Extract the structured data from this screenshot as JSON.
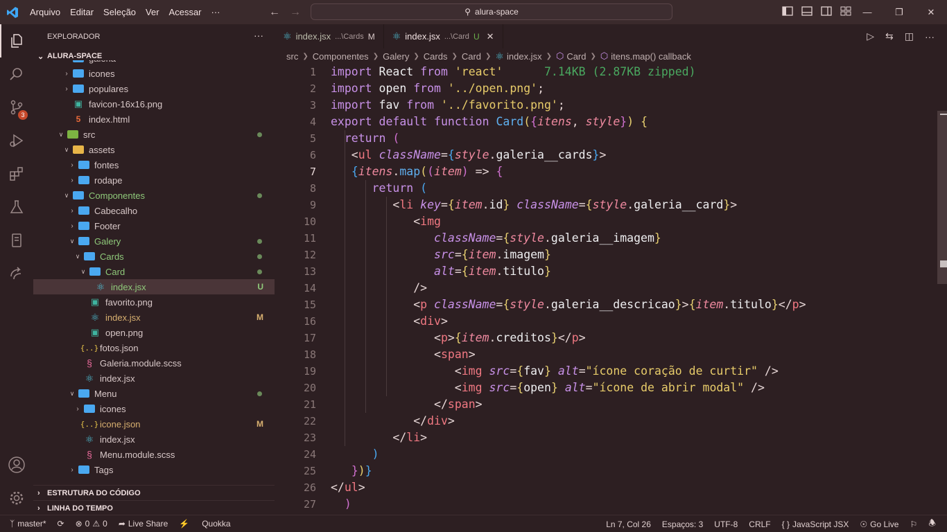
{
  "titlebar": {
    "menu": [
      "Arquivo",
      "Editar",
      "Seleção",
      "Ver",
      "Acessar",
      "···"
    ],
    "command_center": "alura-space"
  },
  "activity": {
    "scm_badge": "3"
  },
  "sidebar": {
    "title": "EXPLORADOR",
    "more": "···",
    "root": "ALURA-SPACE",
    "partial_top": "galeria",
    "items": [
      {
        "label": "icones",
        "depth": 2,
        "kind": "folder",
        "open": false
      },
      {
        "label": "populares",
        "depth": 2,
        "kind": "folder",
        "open": false
      },
      {
        "label": "favicon-16x16.png",
        "depth": 2,
        "kind": "img"
      },
      {
        "label": "index.html",
        "depth": 2,
        "kind": "html"
      },
      {
        "label": "src",
        "depth": 1,
        "kind": "src",
        "open": true,
        "dot": true
      },
      {
        "label": "assets",
        "depth": 2,
        "kind": "assets",
        "open": true
      },
      {
        "label": "fontes",
        "depth": 3,
        "kind": "folder",
        "open": false
      },
      {
        "label": "rodape",
        "depth": 3,
        "kind": "folder",
        "open": false
      },
      {
        "label": "Componentes",
        "depth": 2,
        "kind": "folder",
        "open": true,
        "dot": true,
        "green": true
      },
      {
        "label": "Cabecalho",
        "depth": 3,
        "kind": "folder",
        "open": false
      },
      {
        "label": "Footer",
        "depth": 3,
        "kind": "folder",
        "open": false
      },
      {
        "label": "Galery",
        "depth": 3,
        "kind": "folder",
        "open": true,
        "dot": true,
        "green": true
      },
      {
        "label": "Cards",
        "depth": 4,
        "kind": "folder",
        "open": true,
        "dot": true,
        "green": true
      },
      {
        "label": "Card",
        "depth": 5,
        "kind": "folder",
        "open": true,
        "dot": true,
        "green": true
      },
      {
        "label": "index.jsx",
        "depth": 6,
        "kind": "react",
        "status": "U",
        "selected": true,
        "green": true
      },
      {
        "label": "favorito.png",
        "depth": 5,
        "kind": "img"
      },
      {
        "label": "index.jsx",
        "depth": 5,
        "kind": "react",
        "status": "M"
      },
      {
        "label": "open.png",
        "depth": 5,
        "kind": "img"
      },
      {
        "label": "fotos.json",
        "depth": 4,
        "kind": "json"
      },
      {
        "label": "Galeria.module.scss",
        "depth": 4,
        "kind": "scss"
      },
      {
        "label": "index.jsx",
        "depth": 4,
        "kind": "react"
      },
      {
        "label": "Menu",
        "depth": 3,
        "kind": "folder",
        "open": true,
        "dot": true
      },
      {
        "label": "icones",
        "depth": 4,
        "kind": "folder",
        "open": false
      },
      {
        "label": "icone.json",
        "depth": 4,
        "kind": "json",
        "status": "M"
      },
      {
        "label": "index.jsx",
        "depth": 4,
        "kind": "react"
      },
      {
        "label": "Menu.module.scss",
        "depth": 4,
        "kind": "scss"
      },
      {
        "label": "Tags",
        "depth": 3,
        "kind": "folder",
        "open": false
      }
    ],
    "outline": "ESTRUTURA DO CÓDIGO",
    "timeline": "LINHA DO TEMPO"
  },
  "tabs": [
    {
      "label": "index.jsx",
      "desc": "...\\Cards",
      "mark": "M",
      "active": false
    },
    {
      "label": "index.jsx",
      "desc": "...\\Card",
      "mark": "U",
      "active": true
    }
  ],
  "breadcrumb": [
    "src",
    "Componentes",
    "Galery",
    "Cards",
    "Card",
    "index.jsx",
    "Card",
    "itens.map() callback"
  ],
  "editor": {
    "current_line": 7,
    "import_size": "7.14KB (2.87KB zipped)"
  },
  "status": {
    "branch": "master*",
    "errors": "0",
    "warnings": "0",
    "live_share": "Live Share",
    "quokka": "Quokka",
    "position": "Ln 7, Col 26",
    "spaces": "Espaços: 3",
    "encoding": "UTF-8",
    "eol": "CRLF",
    "language": "JavaScript JSX",
    "go_live": "Go Live"
  }
}
